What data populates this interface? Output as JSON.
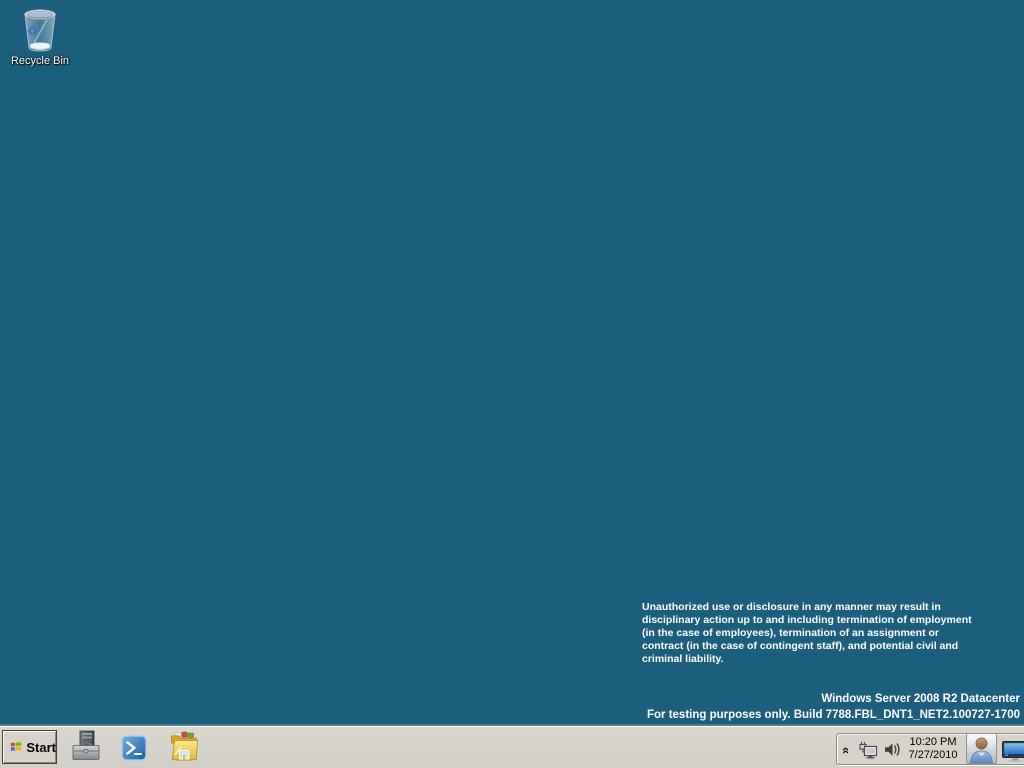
{
  "desktop": {
    "background_color": "#1c5e7d",
    "recycle_bin": {
      "label": "Recycle Bin"
    },
    "watermark": {
      "disclaimer": "Unauthorized use or disclosure in any manner may result in\ndisciplinary action up to and including termination of employment\n(in the case of employees), termination of an assignment or\ncontract (in the case of contingent staff), and potential civil and\ncriminal liability.",
      "edition": "Windows Server 2008 R2 Datacenter",
      "build": "For testing purposes only. Build 7788.FBL_DNT1_NET2.100727-1700"
    }
  },
  "taskbar": {
    "background_color": "#d6d3cb",
    "start": {
      "label": "Start",
      "icon": "windows-flag-icon"
    },
    "quick_launch": [
      {
        "name": "server-manager",
        "icon": "server-manager-icon"
      },
      {
        "name": "windows-powershell",
        "icon": "powershell-icon"
      },
      {
        "name": "windows-explorer",
        "icon": "folder-icon"
      }
    ],
    "tray": {
      "show_hidden_icons_glyph": "«",
      "icons": [
        "network-icon",
        "volume-icon",
        "user-icon",
        "display-icon"
      ],
      "clock": {
        "time": "10:20 PM",
        "date": "7/27/2010"
      }
    }
  }
}
